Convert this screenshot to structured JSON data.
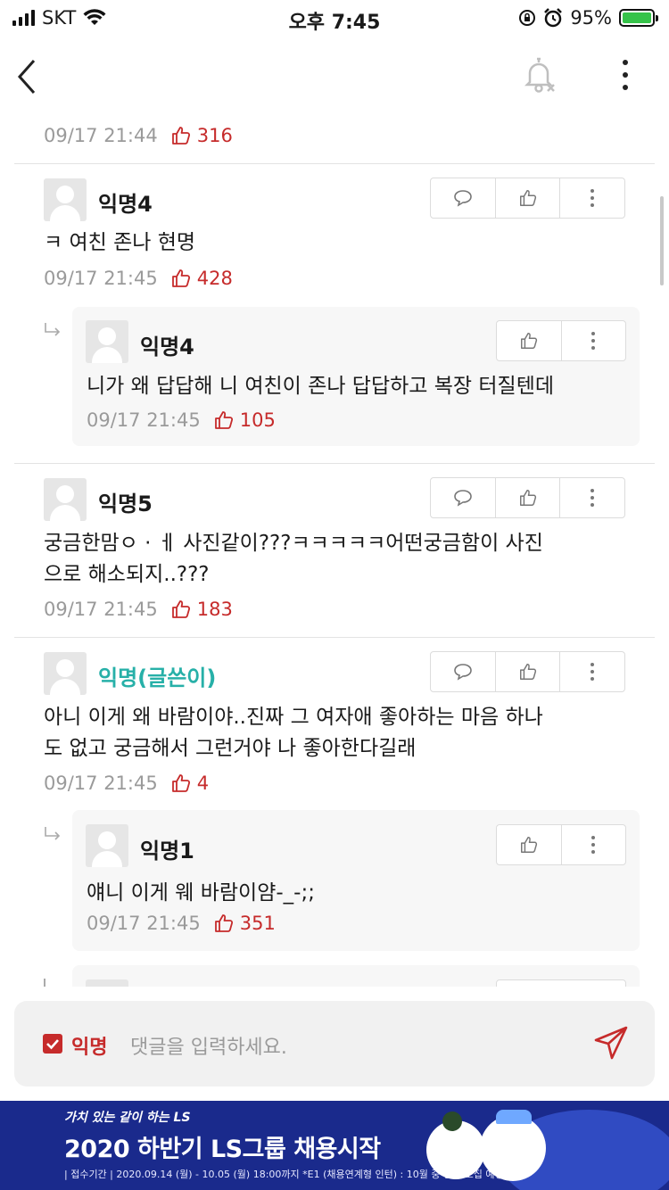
{
  "status": {
    "carrier": "SKT",
    "time": "오후 7:45",
    "battery": "95%"
  },
  "top_meta": {
    "date": "09/17 21:44",
    "likes": "316"
  },
  "comments": [
    {
      "name": "익명4",
      "text": "ㅋ 여친 존나 현명",
      "date": "09/17 21:45",
      "likes": "428"
    },
    {
      "name": "익명4",
      "text": "니가 왜 답답해 니 여친이 존나 답답하고 복장 터질텐데",
      "date": "09/17 21:45",
      "likes": "105"
    },
    {
      "name": "익명5",
      "text_line1": "궁금한맘ㅇ · ㅔ 사진같이???ㅋㅋㅋㅋㅋ어떤궁금함이 사진",
      "text_line2": "으로 해소되지..???",
      "date": "09/17 21:45",
      "likes": "183"
    },
    {
      "name": "익명(글쓴이)",
      "text_line1": "아니 이게 왜 바람이야..진짜 그 여자애 좋아하는 마음 하나",
      "text_line2": "도 없고 궁금해서 그런거야 나 좋아한다길래",
      "date": "09/17 21:45",
      "likes": "4"
    },
    {
      "name": "익명1",
      "text": "얘니 이게 웨 바람이얌-_-;;",
      "date": "09/17 21:45",
      "likes": "351"
    }
  ],
  "input": {
    "anon_label": "익명",
    "placeholder": "댓글을 입력하세요."
  },
  "banner": {
    "line1": "가치 있는 같이 하는 LS",
    "line2": "2020 하반기 LS그룹 채용시작",
    "line3": "| 접수기간 |  2020.09.14 (월) - 10.05 (월) 18:00까지   *E1 (채용연계형 인턴) : 10월 중 별도 모집 예정"
  },
  "colors": {
    "accent": "#c62b2b",
    "author": "#27b0a8",
    "banner": "#1a2a8c"
  }
}
